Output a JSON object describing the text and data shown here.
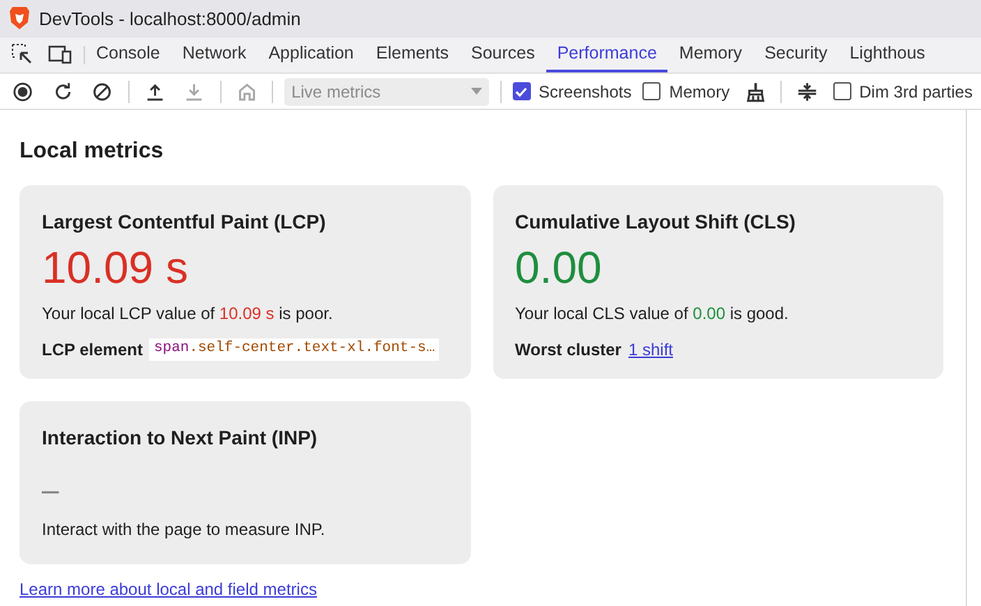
{
  "window": {
    "title": "DevTools - localhost:8000/admin"
  },
  "tabs": [
    {
      "label": "Console",
      "selected": false
    },
    {
      "label": "Network",
      "selected": false
    },
    {
      "label": "Application",
      "selected": false
    },
    {
      "label": "Elements",
      "selected": false
    },
    {
      "label": "Sources",
      "selected": false
    },
    {
      "label": "Performance",
      "selected": true
    },
    {
      "label": "Memory",
      "selected": false
    },
    {
      "label": "Security",
      "selected": false
    },
    {
      "label": "Lighthous",
      "selected": false
    }
  ],
  "toolbar": [
    {
      "kind": "button",
      "disabled": false
    },
    {
      "kind": "button",
      "disabled": false
    },
    {
      "kind": "button",
      "disabled": false
    },
    {
      "kind": "divider"
    },
    {
      "kind": "button",
      "disabled": false
    },
    {
      "kind": "button",
      "disabled": true
    },
    {
      "kind": "divider"
    },
    {
      "kind": "button",
      "disabled": true
    },
    {
      "kind": "divider"
    },
    {
      "kind": "select",
      "value": "Live metrics",
      "disabled": true
    },
    {
      "kind": "divider"
    },
    {
      "kind": "checkbox",
      "label": "Screenshots",
      "checked": true
    },
    {
      "kind": "checkbox",
      "label": "Memory",
      "checked": false
    },
    {
      "kind": "button",
      "disabled": false
    },
    {
      "kind": "divider"
    },
    {
      "kind": "button",
      "disabled": false
    },
    {
      "kind": "checkbox",
      "label": "Dim 3rd parties",
      "checked": false
    }
  ],
  "heading": "Local metrics",
  "cards": [
    {
      "title": "Largest Contentful Paint (LCP)",
      "value": "10.09 s",
      "color": "#d93025",
      "description": [
        {
          "text": "Your local LCP value of ",
          "highlight": false
        },
        {
          "text": "10.09 s",
          "highlight": true
        },
        {
          "text": " is poor.",
          "highlight": false
        }
      ],
      "detail": {
        "kind": "code",
        "label": "LCP element",
        "tag": "span",
        "classes": ".self-center.text-xl.font-s…"
      }
    },
    {
      "title": "Cumulative Layout Shift (CLS)",
      "value": "0.00",
      "color": "#1e8e3e",
      "description": [
        {
          "text": "Your local CLS value of ",
          "highlight": false
        },
        {
          "text": "0.00",
          "highlight": true
        },
        {
          "text": " is good.",
          "highlight": false
        }
      ],
      "detail": {
        "kind": "link",
        "label": "Worst cluster",
        "link": "1 shift"
      }
    },
    {
      "title": "Interaction to Next Paint (INP)",
      "value": "–",
      "color": "#808080",
      "description": [
        {
          "text": "Interact with the page to measure INP.",
          "highlight": false
        }
      ]
    }
  ],
  "footer_link": "Learn more about local and field metrics"
}
